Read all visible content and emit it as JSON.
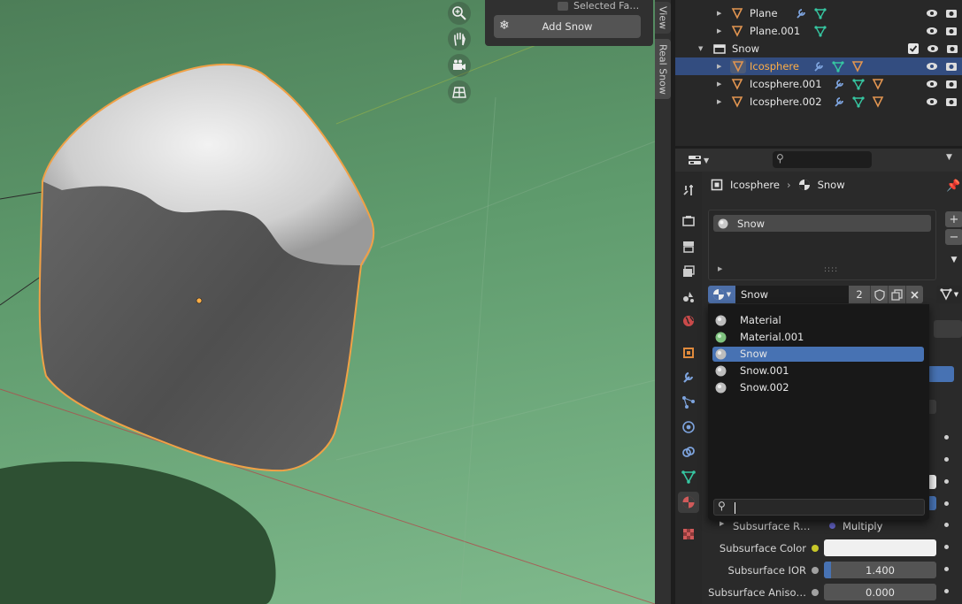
{
  "viewport": {
    "sidebar_tabs": [
      "View",
      "Real Snow"
    ],
    "panel": {
      "selected_faces_label": "Selected Fa…",
      "add_snow_label": "Add Snow",
      "add_snow_icon": "snowflake-icon"
    },
    "gizmo_icons": [
      "zoom-icon",
      "hand-pan-icon",
      "camera-icon",
      "grid-icon"
    ]
  },
  "outliner": {
    "rows": [
      {
        "name": "Plane",
        "type": "mesh",
        "modifiers": [
          "wrench",
          "mesh-data"
        ]
      },
      {
        "name": "Plane.001",
        "type": "mesh",
        "modifiers": [
          "mesh-data"
        ]
      },
      {
        "name": "Snow",
        "type": "collection"
      },
      {
        "name": "Icosphere",
        "type": "mesh",
        "selected": true,
        "modifiers": [
          "wrench",
          "mesh-data",
          "material"
        ]
      },
      {
        "name": "Icosphere.001",
        "type": "mesh",
        "modifiers": [
          "wrench",
          "mesh-data",
          "material"
        ]
      },
      {
        "name": "Icosphere.002",
        "type": "mesh",
        "modifiers": [
          "wrench",
          "mesh-data",
          "material"
        ]
      }
    ]
  },
  "properties": {
    "breadcrumb": {
      "object": "Icosphere",
      "material": "Snow"
    },
    "slots": [
      {
        "name": "Snow"
      }
    ],
    "material_selector": {
      "name": "Snow",
      "users": "2"
    },
    "dropdown": {
      "items": [
        {
          "name": "Material",
          "color": "#bdbdbd"
        },
        {
          "name": "Material.001",
          "color": "#7fc27f"
        },
        {
          "name": "Snow",
          "color": "#bdbdbd",
          "active": true
        },
        {
          "name": "Snow.001",
          "color": "#bdbdbd"
        },
        {
          "name": "Snow.002",
          "color": "#bdbdbd"
        }
      ],
      "search_value": ""
    },
    "rows": [
      {
        "label": "Subsurface R…",
        "kind": "menu",
        "value": "Multiply",
        "dot": "#6363c7",
        "expand": true
      },
      {
        "label": "Subsurface Color",
        "kind": "color",
        "value": "",
        "dot": "#c7c729"
      },
      {
        "label": "Subsurface IOR",
        "kind": "number",
        "value": "1.400",
        "fill": 0.06,
        "dot": "#a1a1a1"
      },
      {
        "label": "Subsurface Aniso…",
        "kind": "number",
        "value": "0.000",
        "fill": 0.0,
        "dot": "#a1a1a1"
      }
    ]
  },
  "colors": {
    "accent_blue": "#4772b3",
    "selection_orange": "#ffae45",
    "outliner_selected": "#334d80"
  }
}
